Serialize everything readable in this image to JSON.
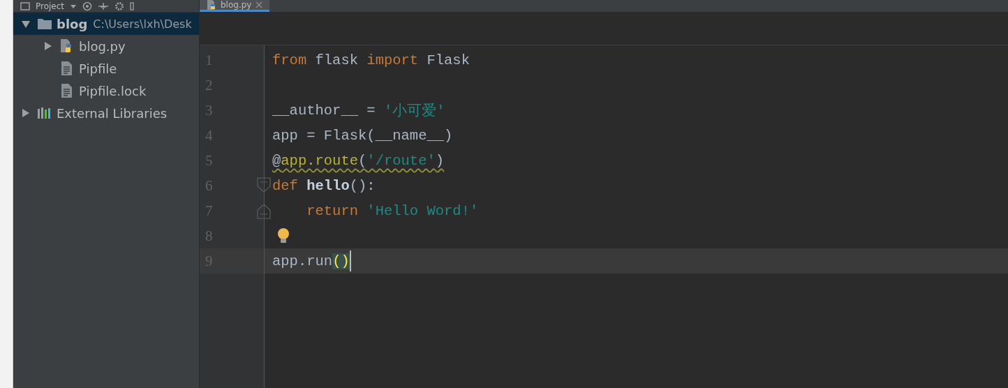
{
  "project_panel": {
    "title": "Project",
    "tree": [
      {
        "label": "blog",
        "path": "C:\\Users\\lxh\\Desk",
        "kind": "folder",
        "expanded": true,
        "selected": true,
        "children": [
          {
            "label": "blog.py",
            "kind": "python",
            "expanded": false,
            "selected": false
          },
          {
            "label": "Pipfile",
            "kind": "file",
            "selected": false
          },
          {
            "label": "Pipfile.lock",
            "kind": "file",
            "selected": false
          }
        ]
      },
      {
        "label": "External Libraries",
        "kind": "library",
        "expanded": false,
        "selected": false
      }
    ]
  },
  "editor": {
    "tabs": [
      {
        "label": "blog.py",
        "selected": true
      }
    ],
    "lines": [
      {
        "number": "1",
        "tokens": [
          {
            "text": "from",
            "kind": "keyword"
          },
          {
            "text": " flask ",
            "kind": "plain"
          },
          {
            "text": "import",
            "kind": "keyword"
          },
          {
            "text": " Flask",
            "kind": "plain"
          }
        ]
      },
      {
        "number": "2"
      },
      {
        "number": "3",
        "tokens": [
          {
            "text": "__author__ = ",
            "kind": "plain"
          },
          {
            "text": "'小可爱'",
            "kind": "string"
          }
        ]
      },
      {
        "number": "4",
        "tokens": [
          {
            "text": "app = Flask(__name__)",
            "kind": "plain"
          }
        ]
      },
      {
        "number": "5",
        "warning": true,
        "tokens": [
          {
            "text": "@",
            "kind": "plain"
          },
          {
            "text": "app.route",
            "kind": "decorator"
          },
          {
            "text": "(",
            "kind": "plain"
          },
          {
            "text": "'/route'",
            "kind": "string"
          },
          {
            "text": ")",
            "kind": "plain"
          }
        ]
      },
      {
        "number": "6",
        "fold_start": true,
        "tokens": [
          {
            "text": "def",
            "kind": "keyword"
          },
          {
            "text": " hello",
            "kind": "funcdef"
          },
          {
            "text": "():",
            "kind": "plain"
          }
        ]
      },
      {
        "number": "7",
        "fold_end": true,
        "tokens": [
          {
            "text": "    return",
            "kind": "keyword"
          },
          {
            "text": " 'Hello Word!'",
            "kind": "string"
          }
        ]
      },
      {
        "number": "8",
        "bulb": true
      },
      {
        "number": "9",
        "current": true,
        "caret": true,
        "tokens": [
          {
            "text": "app.run",
            "kind": "plain"
          },
          {
            "text": "()",
            "kind": "brace-match"
          }
        ]
      }
    ]
  }
}
